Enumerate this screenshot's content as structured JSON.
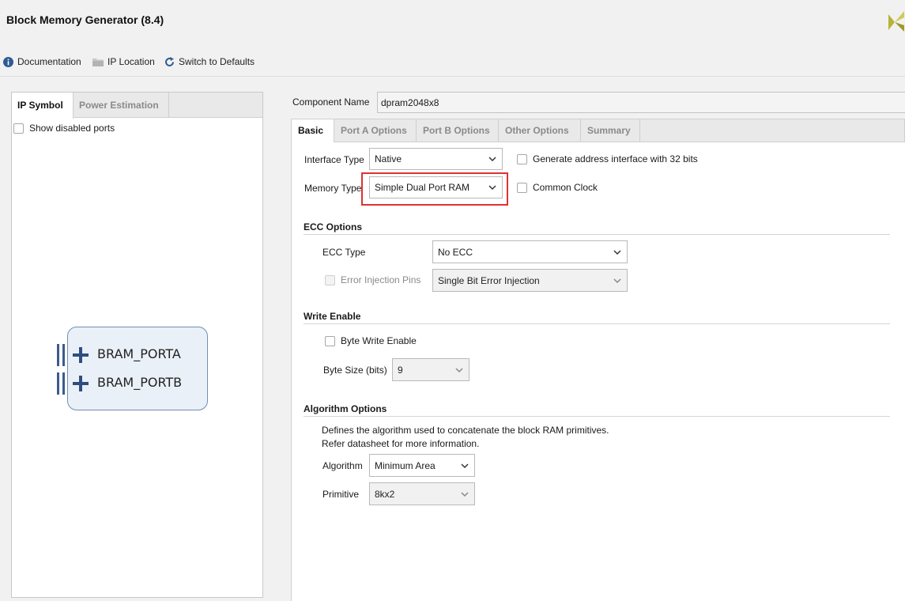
{
  "app": {
    "title": "Block Memory Generator (8.4)"
  },
  "toolbar": {
    "documentation": {
      "label": "Documentation",
      "icon": "info-icon"
    },
    "ip_location": {
      "label": "IP Location",
      "icon": "folder-icon"
    },
    "switch_defaults": {
      "label": "Switch to Defaults",
      "icon": "refresh-icon"
    }
  },
  "left_panel": {
    "tabs": [
      {
        "label": "IP Symbol",
        "active": true
      },
      {
        "label": "Power Estimation",
        "active": false
      }
    ],
    "show_disabled_ports": {
      "label": "Show disabled ports",
      "checked": false
    },
    "symbol": {
      "ports": [
        "BRAM_PORTA",
        "BRAM_PORTB"
      ]
    }
  },
  "component_name": {
    "label": "Component Name",
    "value": "dpram2048x8"
  },
  "tabs": [
    {
      "label": "Basic",
      "active": true
    },
    {
      "label": "Port A Options",
      "active": false
    },
    {
      "label": "Port B Options",
      "active": false
    },
    {
      "label": "Other Options",
      "active": false
    },
    {
      "label": "Summary",
      "active": false
    }
  ],
  "basic": {
    "interface_type": {
      "label": "Interface Type",
      "value": "Native"
    },
    "memory_type": {
      "label": "Memory Type",
      "value": "Simple Dual Port RAM"
    },
    "generate_addr_32": {
      "label": "Generate address interface with 32 bits",
      "checked": false
    },
    "common_clock": {
      "label": "Common Clock",
      "checked": false
    },
    "ecc": {
      "title": "ECC Options",
      "type_label": "ECC Type",
      "type_value": "No ECC",
      "error_injection_label": "Error Injection Pins",
      "error_injection_value": "Single Bit Error Injection",
      "error_injection_checked": false
    },
    "write_enable": {
      "title": "Write Enable",
      "byte_write_label": "Byte Write Enable",
      "byte_write_checked": false,
      "byte_size_label": "Byte Size (bits)",
      "byte_size_value": "9"
    },
    "algorithm": {
      "title": "Algorithm Options",
      "desc1": "Defines the algorithm used to concatenate the block RAM primitives.",
      "desc2": "Refer datasheet for more information.",
      "algorithm_label": "Algorithm",
      "algorithm_value": "Minimum Area",
      "primitive_label": "Primitive",
      "primitive_value": "8kx2"
    }
  },
  "colors": {
    "highlight": "#e03131",
    "port_blue": "#2e4e80",
    "logo": "#b7b337"
  }
}
